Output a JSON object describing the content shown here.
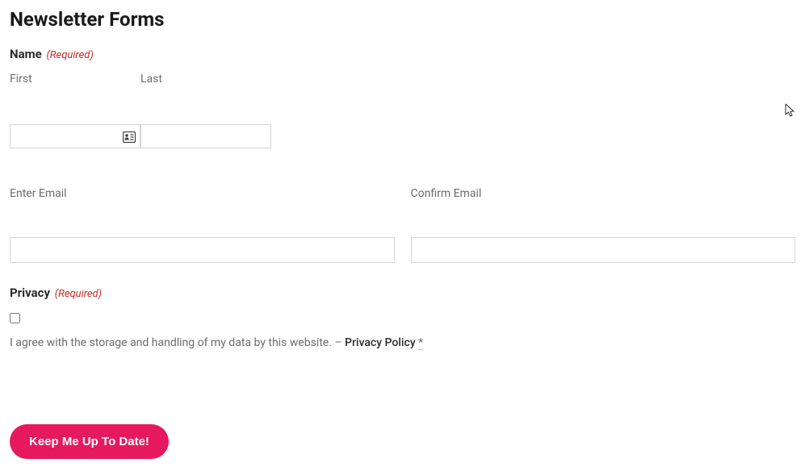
{
  "title": "Newsletter Forms",
  "name_section": {
    "label": "Name",
    "required_text": "(Required)",
    "first_label": "First",
    "last_label": "Last",
    "first_value": "",
    "last_value": ""
  },
  "email_section": {
    "enter_label": "Enter Email",
    "confirm_label": "Confirm Email",
    "enter_value": "",
    "confirm_value": ""
  },
  "privacy_section": {
    "label": "Privacy",
    "required_text": "(Required)",
    "agreement_text": "I agree with the storage and handling of my data by this website. – ",
    "link_text": "Privacy Policy",
    "asterisk": "*"
  },
  "submit": {
    "label": "Keep Me Up To Date!"
  }
}
